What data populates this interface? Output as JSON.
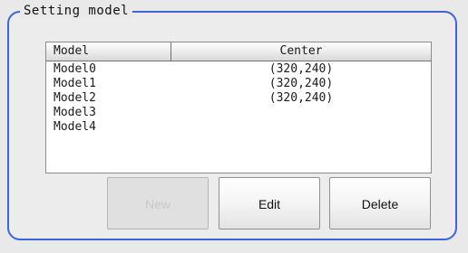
{
  "panel": {
    "title": "Setting model"
  },
  "table": {
    "headers": {
      "model": "Model",
      "center": "Center"
    },
    "rows": [
      {
        "model": "Model0",
        "center": "(320,240)"
      },
      {
        "model": "Model1",
        "center": "(320,240)"
      },
      {
        "model": "Model2",
        "center": "(320,240)"
      },
      {
        "model": "Model3",
        "center": ""
      },
      {
        "model": "Model4",
        "center": ""
      }
    ]
  },
  "buttons": {
    "new_label": "New",
    "edit_label": "Edit",
    "delete_label": "Delete"
  },
  "colors": {
    "panel_border": "#3f63d8",
    "disabled_text": "#c9c9c9"
  }
}
